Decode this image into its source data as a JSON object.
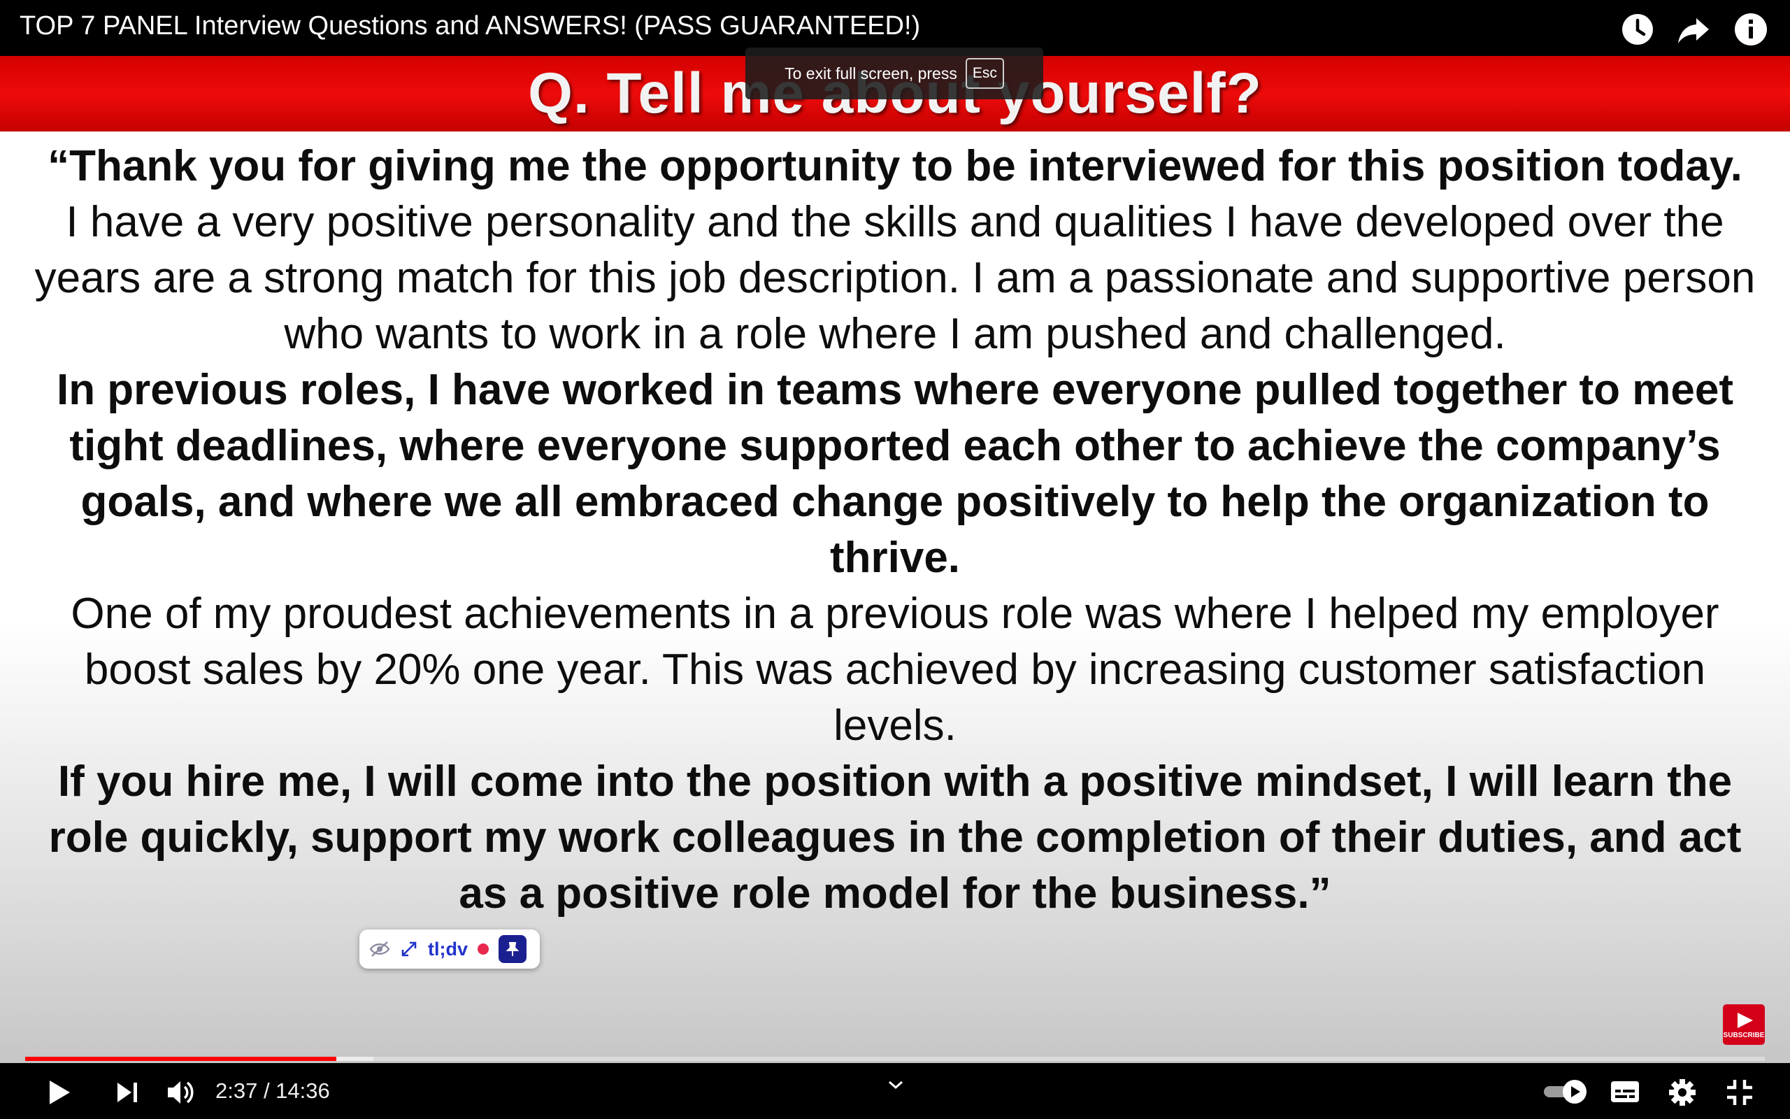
{
  "video": {
    "title": "TOP 7 PANEL Interview Questions and ANSWERS! (PASS GUARANTEED!)",
    "current_time": "2:37",
    "duration": "14:36",
    "time_display": "2:37 / 14:36",
    "played_fraction": 0.179,
    "buffered_fraction": 0.2
  },
  "fullscreen_notice": {
    "text": "To exit full screen, press",
    "key": "Esc"
  },
  "slide": {
    "question": "Q. Tell me about yourself?",
    "paragraphs": [
      {
        "text": "“Thank you for giving me the opportunity to be interviewed for this position today.",
        "bold": true
      },
      {
        "text": "I have a very positive personality and the skills and qualities I have developed over the years are a strong match for this job description. I am a passionate and supportive person who wants to work in a role where I am pushed and challenged.",
        "bold": false
      },
      {
        "text": "In previous roles, I have worked in teams where everyone pulled together to meet tight deadlines, where everyone supported each other to achieve the company’s goals, and where we all embraced change positively to help the organization to thrive.",
        "bold": true
      },
      {
        "text": "One of my proudest achievements in a previous role was where I helped my employer boost sales by 20% one year. This was achieved by increasing customer satisfaction levels.",
        "bold": false
      },
      {
        "text": "If you hire me, I will come into the position with a positive mindset, I will learn the role quickly, support my work colleagues in the completion of their duties, and act as a positive role model for the business.”",
        "bold": true
      }
    ]
  },
  "tldv_widget": {
    "brand": "tl;dv",
    "icons": [
      "eye-off-icon",
      "expand-icon",
      "record-dot-icon",
      "pin-icon"
    ]
  },
  "subscribe_badge": {
    "label": "SUBSCRIBE"
  },
  "top_icons": [
    "watch-later-icon",
    "share-icon",
    "info-icon"
  ],
  "controls": {
    "left": [
      "play-icon",
      "next-icon",
      "volume-icon"
    ],
    "right": [
      "autoplay-toggle",
      "subtitles-icon",
      "settings-icon",
      "exit-fullscreen-icon"
    ],
    "center": "chevron-down-icon",
    "autoplay_on": true
  },
  "colors": {
    "banner_red": "#e60000",
    "progress_red": "#ff0000",
    "tldv_blue": "#2233cc"
  }
}
